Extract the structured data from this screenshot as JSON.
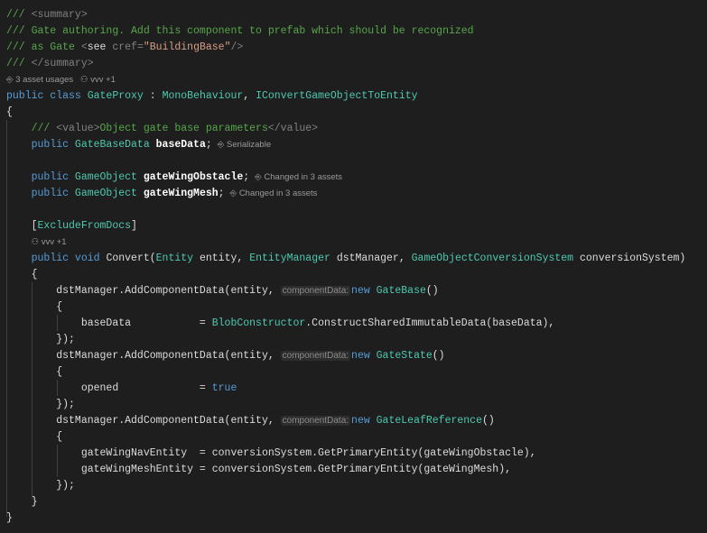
{
  "colors": {
    "background": "#1e1e1e",
    "comment": "#57a64a",
    "keyword": "#569cd6",
    "type": "#4ec9b0",
    "string": "#d69d85",
    "text": "#dcdcdc"
  },
  "lines": [
    [
      [
        "c",
        "/// "
      ],
      [
        "x",
        "<summary>"
      ]
    ],
    [
      [
        "c",
        "/// Gate authoring. Add this component to prefab which should be recognized"
      ]
    ],
    [
      [
        "c",
        "/// as Gate "
      ],
      [
        "x",
        "<"
      ],
      [
        "p",
        "see "
      ],
      [
        "x",
        "cref="
      ],
      [
        "s",
        "\"BuildingBase\""
      ],
      [
        "x",
        "/>"
      ]
    ],
    [
      [
        "c",
        "/// "
      ],
      [
        "x",
        "</summary>"
      ]
    ],
    [
      [
        "lens",
        "⎆ 3 asset usages   ⚇ vvv +1"
      ]
    ],
    [
      [
        "k",
        "public class "
      ],
      [
        "t",
        "GateProxy"
      ],
      [
        "p",
        " : "
      ],
      [
        "t",
        "MonoBehaviour"
      ],
      [
        "p",
        ", "
      ],
      [
        "t",
        "IConvertGameObjectToEntity"
      ]
    ],
    [
      [
        "p",
        "{"
      ]
    ],
    [
      [
        "p",
        "    "
      ],
      [
        "c",
        "/// "
      ],
      [
        "x",
        "<value>"
      ],
      [
        "c",
        "Object gate base parameters"
      ],
      [
        "x",
        "</value>"
      ]
    ],
    [
      [
        "p",
        "    "
      ],
      [
        "k",
        "public "
      ],
      [
        "t",
        "GateBaseData "
      ],
      [
        "b",
        "baseData"
      ],
      [
        "p",
        ";"
      ],
      [
        "inl",
        "⎆ Serializable"
      ]
    ],
    [],
    [
      [
        "p",
        "    "
      ],
      [
        "k",
        "public "
      ],
      [
        "t",
        "GameObject "
      ],
      [
        "b",
        "gateWingObstacle"
      ],
      [
        "p",
        ";"
      ],
      [
        "inl",
        "⎆ Changed in 3 assets"
      ]
    ],
    [
      [
        "p",
        "    "
      ],
      [
        "k",
        "public "
      ],
      [
        "t",
        "GameObject "
      ],
      [
        "b",
        "gateWingMesh"
      ],
      [
        "p",
        ";"
      ],
      [
        "inl",
        "⎆ Changed in 3 assets"
      ]
    ],
    [],
    [
      [
        "p",
        "    "
      ],
      [
        "p",
        "["
      ],
      [
        "t",
        "ExcludeFromDocs"
      ],
      [
        "p",
        "]"
      ]
    ],
    [
      [
        "p",
        "    "
      ],
      [
        "lens",
        "⚇ vvv +1"
      ]
    ],
    [
      [
        "p",
        "    "
      ],
      [
        "k",
        "public void "
      ],
      [
        "p",
        "Convert("
      ],
      [
        "t",
        "Entity "
      ],
      [
        "p",
        "entity, "
      ],
      [
        "t",
        "EntityManager "
      ],
      [
        "p",
        "dstManager, "
      ],
      [
        "t",
        "GameObjectConversionSystem "
      ],
      [
        "p",
        "conversionSystem)"
      ]
    ],
    [
      [
        "p",
        "    {"
      ]
    ],
    [
      [
        "p",
        "        dstManager.AddComponentData(entity, "
      ],
      [
        "hint",
        "componentData:"
      ],
      [
        "k",
        "new "
      ],
      [
        "t",
        "GateBase"
      ],
      [
        "p",
        "()"
      ]
    ],
    [
      [
        "p",
        "        {"
      ]
    ],
    [
      [
        "p",
        "            baseData           = "
      ],
      [
        "t",
        "BlobConstructor"
      ],
      [
        "p",
        ".ConstructSharedImmutableData(baseData),"
      ]
    ],
    [
      [
        "p",
        "        });"
      ]
    ],
    [
      [
        "p",
        "        dstManager.AddComponentData(entity, "
      ],
      [
        "hint",
        "componentData:"
      ],
      [
        "k",
        "new "
      ],
      [
        "t",
        "GateState"
      ],
      [
        "p",
        "()"
      ]
    ],
    [
      [
        "p",
        "        {"
      ]
    ],
    [
      [
        "p",
        "            opened             = "
      ],
      [
        "k",
        "true"
      ]
    ],
    [
      [
        "p",
        "        });"
      ]
    ],
    [
      [
        "p",
        "        dstManager.AddComponentData(entity, "
      ],
      [
        "hint",
        "componentData:"
      ],
      [
        "k",
        "new "
      ],
      [
        "t",
        "GateLeafReference"
      ],
      [
        "p",
        "()"
      ]
    ],
    [
      [
        "p",
        "        {"
      ]
    ],
    [
      [
        "p",
        "            gateWingNavEntity  = conversionSystem.GetPrimaryEntity(gateWingObstacle),"
      ]
    ],
    [
      [
        "p",
        "            gateWingMeshEntity = conversionSystem.GetPrimaryEntity(gateWingMesh),"
      ]
    ],
    [
      [
        "p",
        "        });"
      ]
    ],
    [
      [
        "p",
        "    }"
      ]
    ],
    [
      [
        "p",
        "}"
      ]
    ]
  ]
}
